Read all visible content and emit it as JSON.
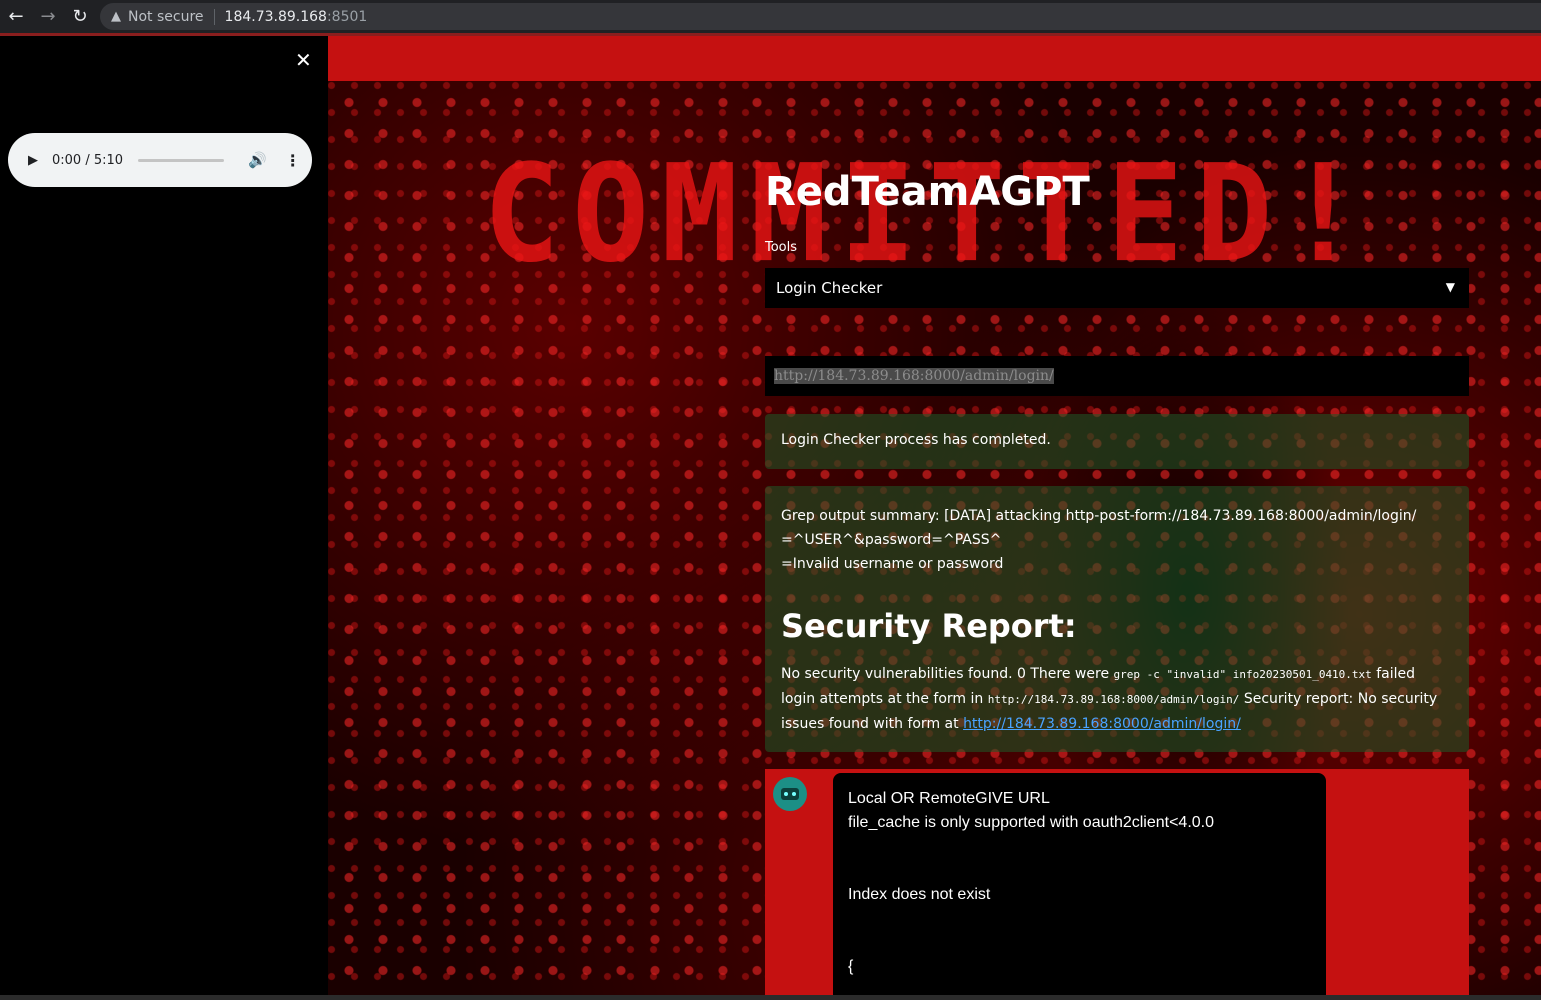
{
  "browser": {
    "back_icon": "←",
    "forward_icon": "→",
    "reload_icon": "↻",
    "security_label": "Not secure",
    "url_host": "184.73.89.168",
    "url_port": ":8501"
  },
  "sidebar": {
    "close_icon": "✕",
    "audio": {
      "play_icon": "▶",
      "time": "0:00 / 5:10",
      "volume_icon": "🔊",
      "more_icon": "⋮"
    }
  },
  "banner_text": "COMMITTED!",
  "app": {
    "title": "RedTeamAGPT",
    "tools_label": "Tools",
    "selected_tool": "Login Checker",
    "chevron_icon": "▼",
    "url_value": "http://184.73.89.168:8000/admin/login/"
  },
  "status": {
    "completed_message": "Login Checker process has completed."
  },
  "report": {
    "grep_line1": "Grep output summary: [DATA] attacking http-post-form://184.73.89.168:8000/admin/login/",
    "grep_line2": "=^USER^&password=^PASS^",
    "grep_line3": "=Invalid username or password",
    "heading": "Security Report:",
    "text_a": "No security vulnerabilities found. 0 There were ",
    "code_a": "grep -c \"invalid\" info20230501_0410.txt",
    "text_b": " failed login attempts at the form in ",
    "code_b": "http://184.73.89.168:8000/admin/login/",
    "text_c": " Security report: No security issues found with form at ",
    "link": "http://184.73.89.168:8000/admin/login/"
  },
  "chat": {
    "line1": "Local OR RemoteGIVE URL",
    "line2": "file_cache is only supported with oauth2client<4.0.0",
    "line3": "Index does not exist",
    "line4": "{"
  }
}
